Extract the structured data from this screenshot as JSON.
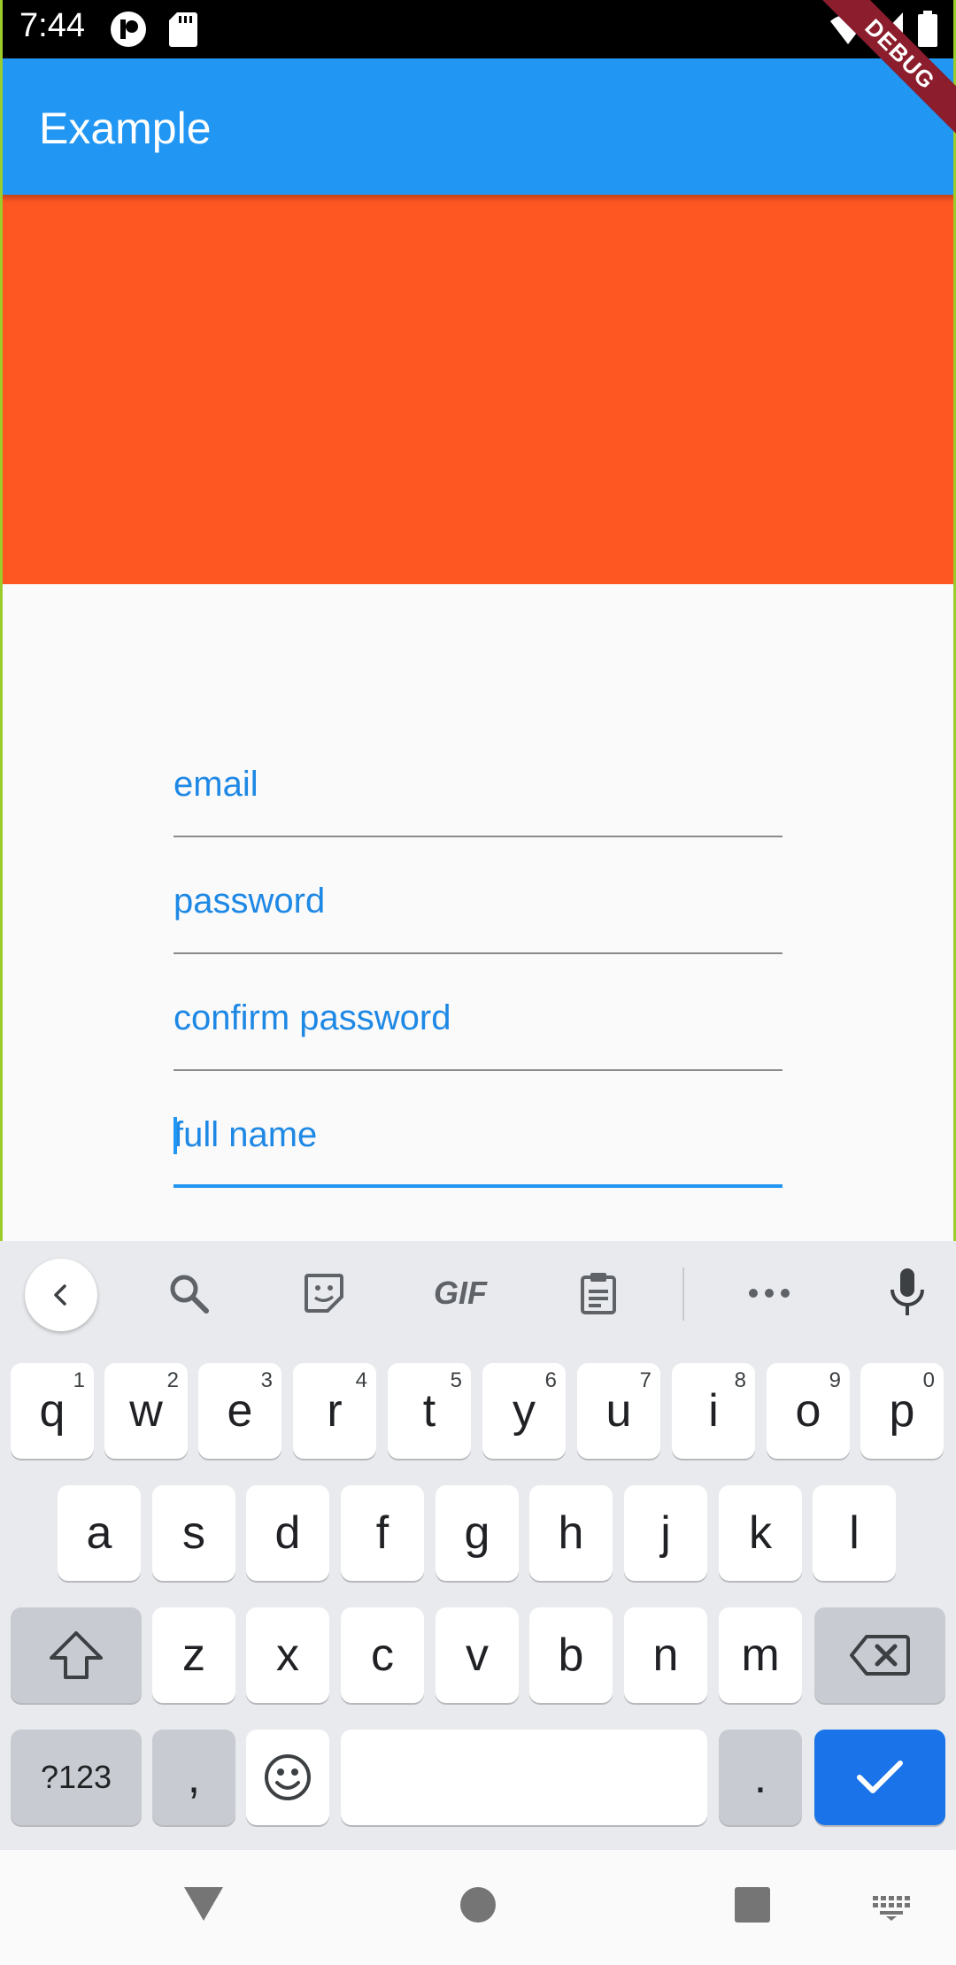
{
  "status_bar": {
    "time": "7:44"
  },
  "app_bar": {
    "title": "Example",
    "debug_banner": "DEBUG"
  },
  "form": {
    "fields": [
      {
        "label": "email"
      },
      {
        "label": "password"
      },
      {
        "label": "confirm password"
      },
      {
        "label": "full name",
        "focused": true
      }
    ]
  },
  "keyboard": {
    "toolbar": [
      "back",
      "search-icon",
      "sticker-icon",
      "GIF",
      "clipboard-icon",
      "more-icon",
      "mic-icon"
    ],
    "gif_label": "GIF",
    "row1": [
      {
        "k": "q",
        "h": "1"
      },
      {
        "k": "w",
        "h": "2"
      },
      {
        "k": "e",
        "h": "3"
      },
      {
        "k": "r",
        "h": "4"
      },
      {
        "k": "t",
        "h": "5"
      },
      {
        "k": "y",
        "h": "6"
      },
      {
        "k": "u",
        "h": "7"
      },
      {
        "k": "i",
        "h": "8"
      },
      {
        "k": "o",
        "h": "9"
      },
      {
        "k": "p",
        "h": "0"
      }
    ],
    "row2": [
      "a",
      "s",
      "d",
      "f",
      "g",
      "h",
      "j",
      "k",
      "l"
    ],
    "row3": [
      "z",
      "x",
      "c",
      "v",
      "b",
      "n",
      "m"
    ],
    "symbols_label": "?123",
    "comma": ",",
    "period": "."
  },
  "colors": {
    "app_bar": "#2196f3",
    "hero": "#ff5722",
    "accent": "#1e88e5",
    "enter_key": "#1a73e8",
    "debug_banner": "#8b1d2c"
  }
}
